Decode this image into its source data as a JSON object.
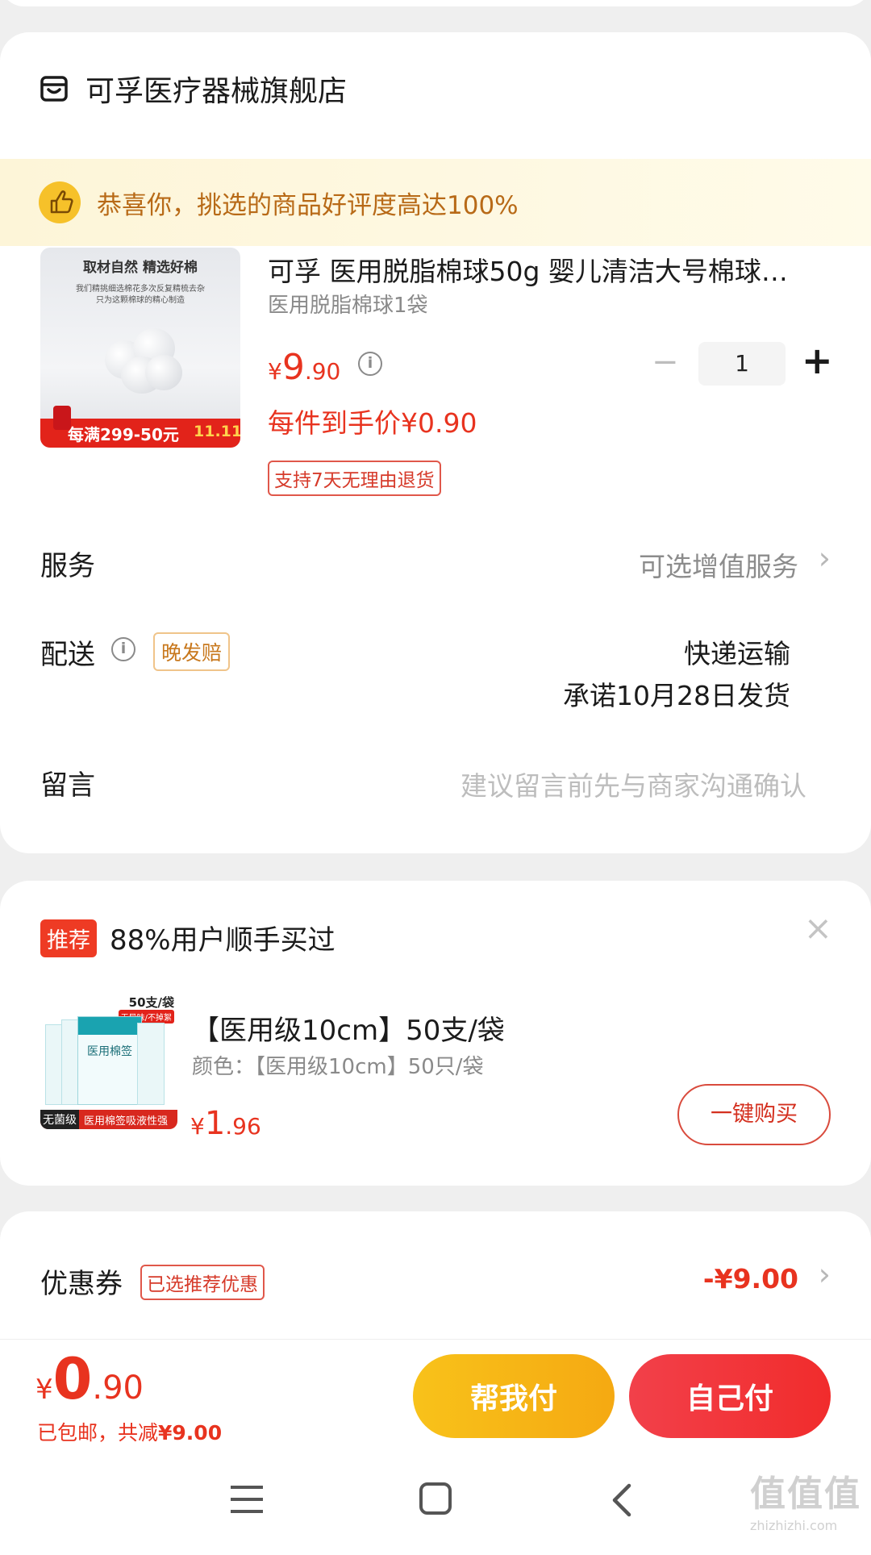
{
  "colors": {
    "accent": "#e8331f",
    "yellow": "#f6b417",
    "banner_text": "#b86a17"
  },
  "store": {
    "name": "可孚医疗器械旗舰店",
    "icon": "store-icon"
  },
  "banner": {
    "text": "恭喜你，挑选的商品好评度高达100%",
    "icon": "thumbs-up-icon"
  },
  "product": {
    "image_text_top": "取材自然 精选好棉",
    "image_text_desc1": "我们精挑细选棉花多次反复精梳去杂",
    "image_text_desc2": "只为这颗棉球的精心制造",
    "image_promo": "每满299-50元",
    "image_badge": "11.11",
    "title": "可孚 医用脱脂棉球50g 婴儿清洁大号棉球…",
    "spec": "医用脱脂棉球1袋",
    "price_symbol": "¥",
    "price_int": "9",
    "price_dec": ".90",
    "final_price": "每件到手价¥0.90",
    "return_tag": "支持7天无理由退货",
    "quantity": "1",
    "minus": "−",
    "plus": "+"
  },
  "service": {
    "label": "服务",
    "value": "可选增值服务"
  },
  "delivery": {
    "label": "配送",
    "badge": "晚发赔",
    "method": "快递运输",
    "promise": "承诺10月28日发货"
  },
  "message": {
    "label": "留言",
    "placeholder": "建议留言前先与商家沟通确认"
  },
  "recommend": {
    "tag": "推荐",
    "title": "88%用户顺手买过",
    "close": "×",
    "image_top": "50支/袋",
    "image_sub": "无异味/不掉絮",
    "image_pack": "医用棉签",
    "image_bottom_left": "无菌级",
    "image_bottom_right": "医用棉签吸液性强",
    "item_title": "【医用级10cm】50支/袋",
    "item_spec": "颜色：【医用级10cm】50只/袋",
    "price_symbol": "¥",
    "price_int": "1",
    "price_dec": ".96",
    "buy_button": "一键购买"
  },
  "coupon": {
    "label": "优惠券",
    "tag": "已选推荐优惠",
    "value": "-¥9.00"
  },
  "footer": {
    "price_symbol": "¥",
    "price_int": "0",
    "price_dec": ".90",
    "note_prefix": "已包邮，共减",
    "note_value": "¥9.00",
    "help_pay": "帮我付",
    "self_pay": "自己付"
  },
  "navbar": {
    "menu": "menu-icon",
    "home": "home-icon",
    "back": "back-icon"
  },
  "watermark": {
    "text": "值值值",
    "url": "zhizhizhi.com"
  }
}
